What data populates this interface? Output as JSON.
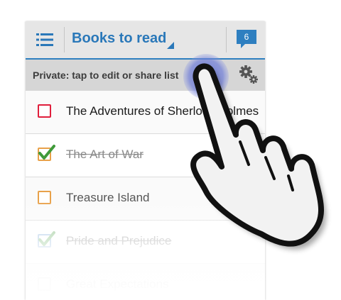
{
  "header": {
    "menu_icon": "list-menu-icon",
    "title": "Books to read",
    "notification_count": "6",
    "notification_icon": "speech-bubble-icon"
  },
  "subbar": {
    "text": "Private: tap to edit or share list",
    "settings_icon": "gear-icon"
  },
  "items": [
    {
      "label": "The Adventures of Sherlock Holmes",
      "checked": false
    },
    {
      "label": "The Art of War",
      "checked": true
    },
    {
      "label": "Treasure Island",
      "checked": false
    },
    {
      "label": "Pride and Prejudice",
      "checked": true
    },
    {
      "label": "Great Expectations",
      "checked": false
    }
  ],
  "overlay": {
    "icon": "pointing-hand-icon"
  },
  "colors": {
    "accent": "#2e7fc0",
    "checkbox_active": "#e01e3c",
    "checkbox_default": "#e8a14a",
    "checkmark": "#3f9a3a"
  }
}
